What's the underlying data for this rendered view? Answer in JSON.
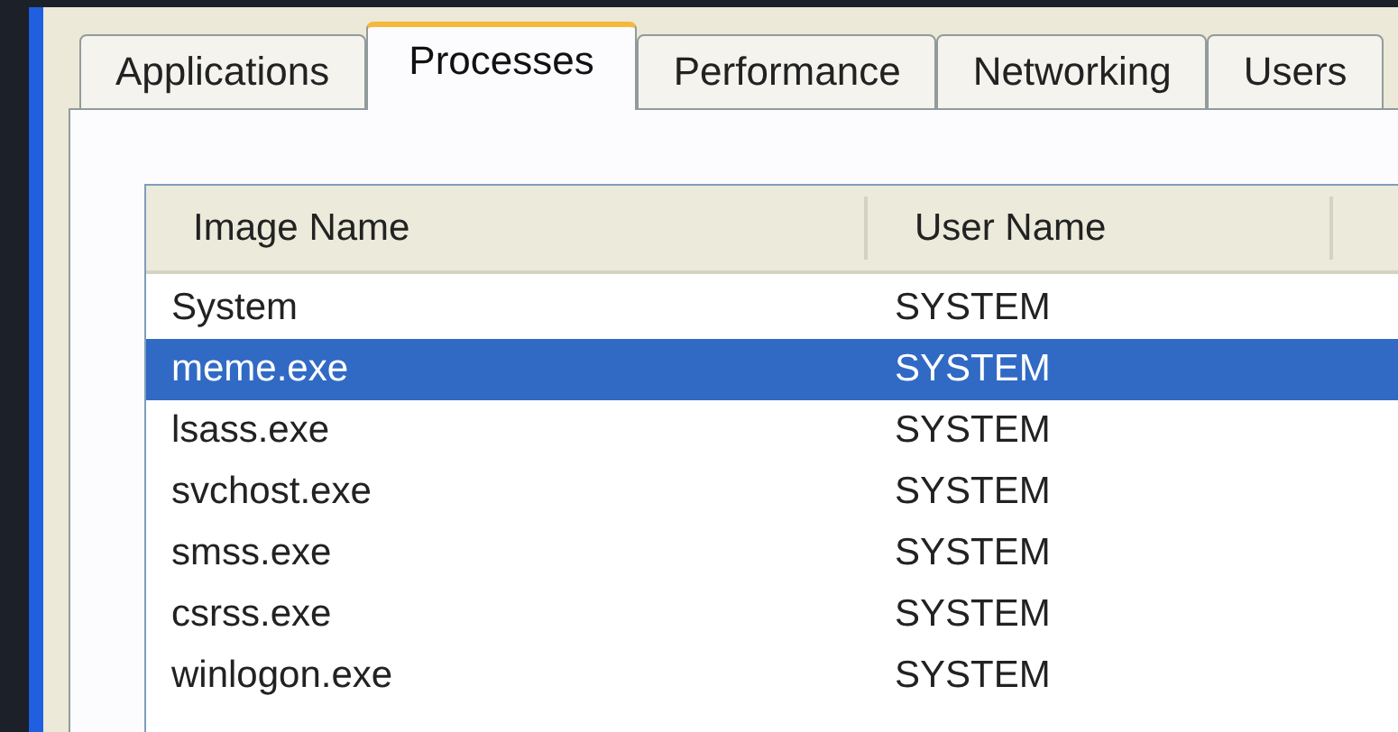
{
  "tabs": [
    {
      "label": "Applications",
      "selected": false
    },
    {
      "label": "Processes",
      "selected": true
    },
    {
      "label": "Performance",
      "selected": false
    },
    {
      "label": "Networking",
      "selected": false
    },
    {
      "label": "Users",
      "selected": false
    }
  ],
  "process_table": {
    "columns": [
      "Image Name",
      "User Name"
    ],
    "rows": [
      {
        "image_name": "System",
        "user_name": "SYSTEM",
        "selected": false
      },
      {
        "image_name": "meme.exe",
        "user_name": "SYSTEM",
        "selected": true
      },
      {
        "image_name": "lsass.exe",
        "user_name": "SYSTEM",
        "selected": false
      },
      {
        "image_name": "svchost.exe",
        "user_name": "SYSTEM",
        "selected": false
      },
      {
        "image_name": "smss.exe",
        "user_name": "SYSTEM",
        "selected": false
      },
      {
        "image_name": "csrss.exe",
        "user_name": "SYSTEM",
        "selected": false
      },
      {
        "image_name": "winlogon.exe",
        "user_name": "SYSTEM",
        "selected": false
      }
    ]
  }
}
